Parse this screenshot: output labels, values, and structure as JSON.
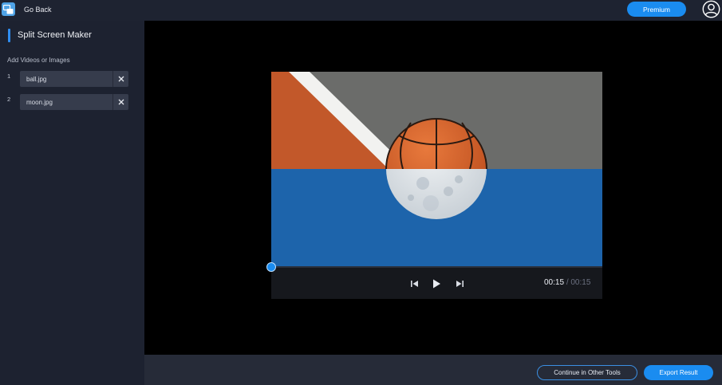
{
  "topbar": {
    "go_back_label": "Go Back",
    "premium_label": "Premium"
  },
  "sidebar": {
    "title": "Split Screen Maker",
    "section_label": "Add Videos or Images",
    "files": [
      {
        "index": "1",
        "name": "ball.jpg"
      },
      {
        "index": "2",
        "name": "moon.jpg"
      }
    ]
  },
  "player": {
    "current_time": "00:15",
    "separator": "/",
    "duration": "00:15",
    "progress": 0
  },
  "footer": {
    "continue_label": "Continue in Other Tools",
    "export_label": "Export Result"
  },
  "colors": {
    "accent": "#1a8cf0",
    "sidebar_bg": "#1d2230",
    "canvas_bg": "#000000",
    "court_orange": "#c2582a",
    "court_gray": "#6d6e6c",
    "sky_blue": "#1d64ab"
  }
}
